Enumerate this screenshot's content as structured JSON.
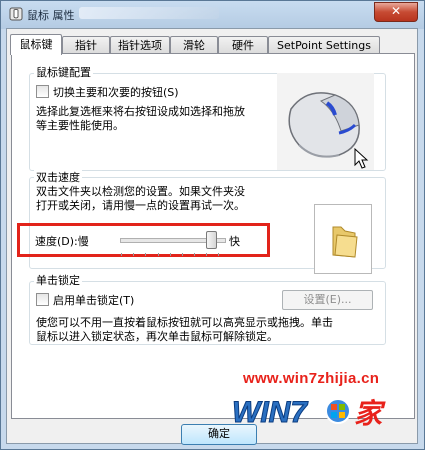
{
  "window": {
    "title": "鼠标 属性",
    "close_label": "✕"
  },
  "tabs": [
    {
      "label": "鼠标键",
      "active": true
    },
    {
      "label": "指针"
    },
    {
      "label": "指针选项"
    },
    {
      "label": "滑轮"
    },
    {
      "label": "硬件"
    },
    {
      "label": "SetPoint Settings"
    }
  ],
  "button_config": {
    "title": "鼠标键配置",
    "checkbox_label": "切换主要和次要的按钮(S)",
    "desc_line1": "选择此复选框来将右按钮设成如选择和拖放",
    "desc_line2": "等主要性能使用。"
  },
  "double_click": {
    "title": "双击速度",
    "desc_line1": "双击文件夹以检测您的设置。如果文件夹没",
    "desc_line2": "打开或关闭，请用慢一点的设置再试一次。",
    "speed_label": "速度(D):慢",
    "fast_label": "快",
    "speed_value": 0.9
  },
  "click_lock": {
    "title": "单击锁定",
    "checkbox_label": "启用单击锁定(T)",
    "settings_label": "设置(E)...",
    "desc_line1": "使您可以不用一直按着鼠标按钮就可以高亮显示或拖拽。单击",
    "desc_line2": "鼠标以进入锁定状态，再次单击鼠标可解除锁定。"
  },
  "footer": {
    "ok_label": "确定"
  },
  "watermark": {
    "url": "www.win7zhijia.cn",
    "logo": "WIN7.家"
  },
  "colors": {
    "highlight": "#e2231a",
    "watermark_red": "#e8221b",
    "watermark_blue": "#2a6fc0"
  }
}
